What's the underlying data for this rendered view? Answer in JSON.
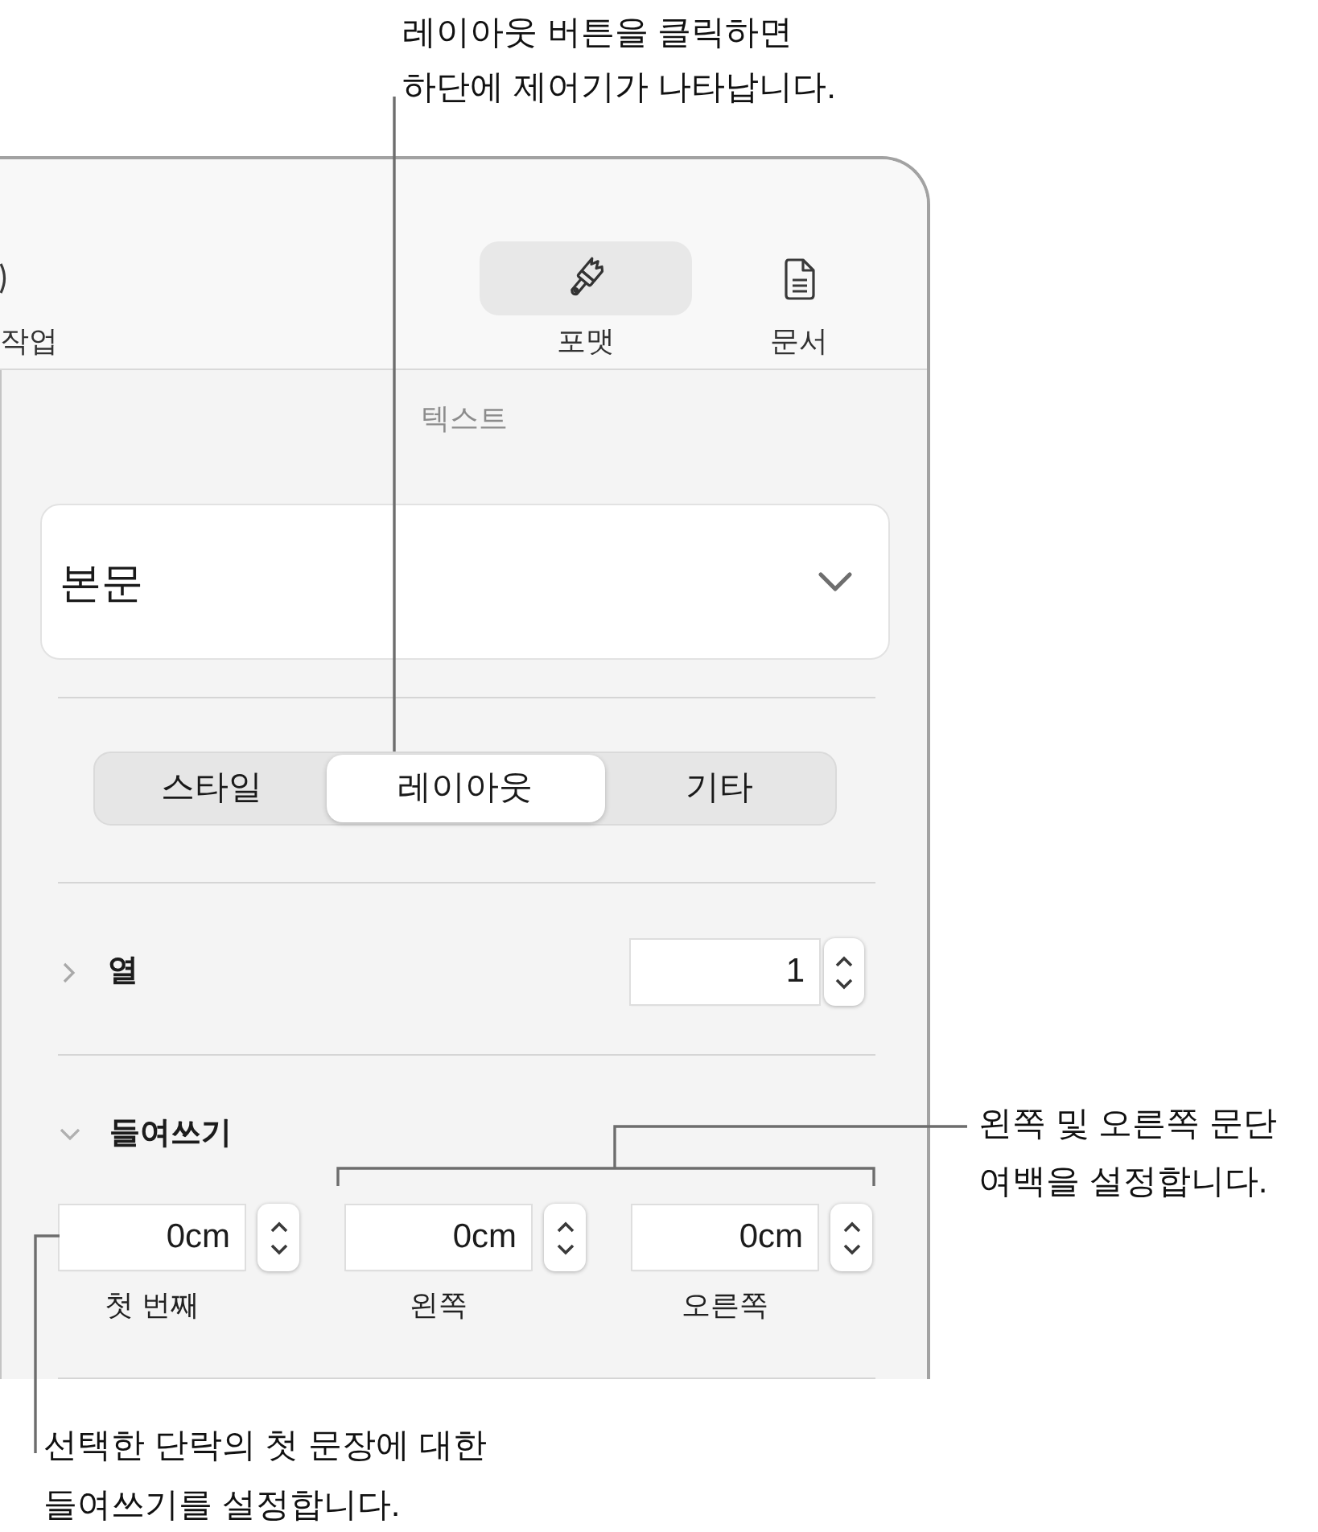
{
  "callouts": {
    "layout_button": "레이아웃 버튼을 클릭하면\n하단에 제어기가 나타납니다.",
    "margins": "왼쪽 및 오른쪽 문단\n여백을 설정합니다.",
    "first_line_indent": "선택한 단락의 첫 문장에 대한\n들여쓰기를 설정합니다."
  },
  "toolbar": {
    "items": [
      {
        "label": "작업",
        "selected": false
      },
      {
        "label": "포맷",
        "selected": true
      },
      {
        "label": "문서",
        "selected": false
      }
    ]
  },
  "section_title": "텍스트",
  "paragraph_style": {
    "value": "본문"
  },
  "tabs": [
    {
      "label": "스타일",
      "selected": false
    },
    {
      "label": "레이아웃",
      "selected": true
    },
    {
      "label": "기타",
      "selected": false
    }
  ],
  "columns": {
    "label": "열",
    "expanded": false,
    "value": "1"
  },
  "indents": {
    "label": "들여쓰기",
    "expanded": true,
    "fields": [
      {
        "value": "0cm",
        "label": "첫 번째"
      },
      {
        "value": "0cm",
        "label": "왼쪽"
      },
      {
        "value": "0cm",
        "label": "오른쪽"
      }
    ]
  }
}
